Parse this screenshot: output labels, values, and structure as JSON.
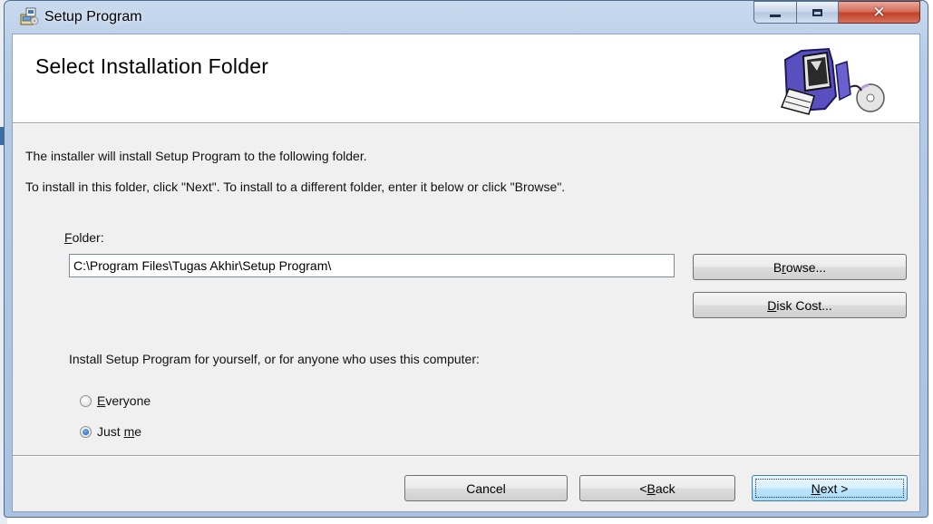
{
  "window": {
    "title": "Setup Program",
    "controls": {
      "minimize_icon": "minimize-icon",
      "maximize_icon": "maximize-icon",
      "close_icon": "close-icon"
    }
  },
  "banner": {
    "title": "Select Installation Folder",
    "graphic_icon": "computer-cd-icon"
  },
  "body": {
    "line1": "The installer will install Setup Program to the following folder.",
    "line2": "To install in this folder, click \"Next\". To install to a different folder, enter it below or click \"Browse\"."
  },
  "folder": {
    "label": {
      "mnemonic": "F",
      "rest": "older:"
    },
    "value": "C:\\Program Files\\Tugas Akhir\\Setup Program\\",
    "browse_button": {
      "pre": "B",
      "mnemonic": "r",
      "post": "owse..."
    },
    "disk_cost_button": {
      "mnemonic": "D",
      "post": "isk Cost..."
    }
  },
  "install_scope": {
    "prompt": "Install Setup Program for yourself, or for anyone who uses this computer:",
    "options": [
      {
        "pre": "",
        "mnemonic": "E",
        "post": "veryone",
        "selected": false
      },
      {
        "pre": "Just ",
        "mnemonic": "m",
        "post": "e",
        "selected": true
      }
    ]
  },
  "footer": {
    "cancel": "Cancel",
    "back": {
      "pre": "< ",
      "mnemonic": "B",
      "post": "ack"
    },
    "next": {
      "mnemonic": "N",
      "post": "ext >"
    }
  },
  "colors": {
    "title_bar": "#b5cbe6",
    "close_button": "#c2412a",
    "dialog_bg": "#f0f0f0",
    "default_button_border": "#3c7fb1"
  }
}
